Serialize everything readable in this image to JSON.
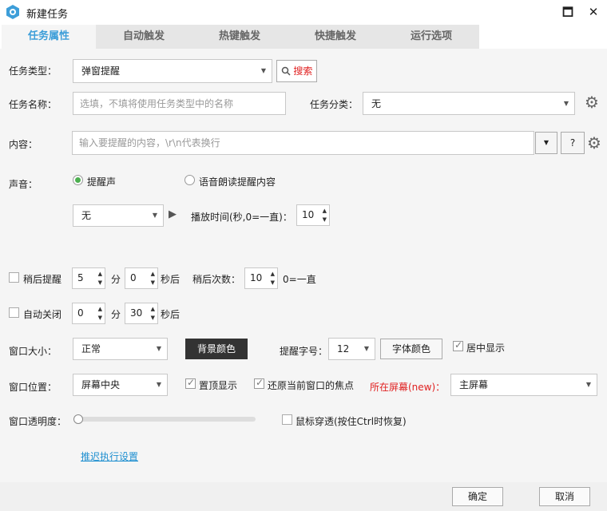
{
  "window": {
    "title": "新建任务",
    "maximize_glyph": "🗖",
    "close_glyph": "✕"
  },
  "tabs": [
    {
      "label": "任务属性",
      "active": true
    },
    {
      "label": "自动触发",
      "active": false
    },
    {
      "label": "热键触发",
      "active": false
    },
    {
      "label": "快捷触发",
      "active": false
    },
    {
      "label": "运行选项",
      "active": false
    }
  ],
  "task_type": {
    "label": "任务类型：",
    "value": "弹窗提醒",
    "search_label": "搜索"
  },
  "task_name": {
    "label": "任务名称：",
    "placeholder": "选填，不填将使用任务类型中的名称"
  },
  "task_category": {
    "label": "任务分类：",
    "value": "无"
  },
  "content": {
    "label": "内容：",
    "placeholder": "输入要提醒的内容，\\r\\n代表换行",
    "help_label": "?"
  },
  "sound": {
    "label": "声音：",
    "option1": "提醒声",
    "option2": "语音朗读提醒内容",
    "selected": "提醒声",
    "sound_value": "无",
    "play_time_label": "播放时间(秒,0=一直)：",
    "play_time_value": "10"
  },
  "snooze": {
    "label": "稍后提醒",
    "checked": false,
    "minutes": "5",
    "min_unit": "分",
    "seconds": "0",
    "sec_unit": "秒后",
    "count_label": "稍后次数：",
    "count": "10",
    "count_hint": "0=一直"
  },
  "auto_close": {
    "label": "自动关闭",
    "checked": false,
    "minutes": "0",
    "min_unit": "分",
    "seconds": "30",
    "sec_unit": "秒后"
  },
  "window_size": {
    "label": "窗口大小：",
    "value": "正常",
    "bg_color_label": "背景颜色",
    "font_size_label": "提醒字号：",
    "font_size": "12",
    "font_color_label": "字体颜色",
    "center_label": "居中显示",
    "center_checked": true
  },
  "window_pos": {
    "label": "窗口位置：",
    "value": "屏幕中央",
    "topmost_label": "置顶显示",
    "topmost_checked": true,
    "restore_focus_label": "还原当前窗口的焦点",
    "restore_focus_checked": true,
    "screen_label": "所在屏幕(new)：",
    "screen_value": "主屏幕"
  },
  "opacity": {
    "label": "窗口透明度：",
    "value_fraction": 0.0,
    "click_through_label": "鼠标穿透(按住Ctrl时恢复)",
    "click_through_checked": false
  },
  "delay_link": "推迟执行设置",
  "footer": {
    "ok_label": "确定",
    "cancel_label": "取消"
  },
  "colors": {
    "accent": "#3d9ed9",
    "tab_bg": "#e6e6e6",
    "content_bg": "#f5f5f5",
    "red_label": "#e02020",
    "bg_color_btn": "#333333"
  }
}
